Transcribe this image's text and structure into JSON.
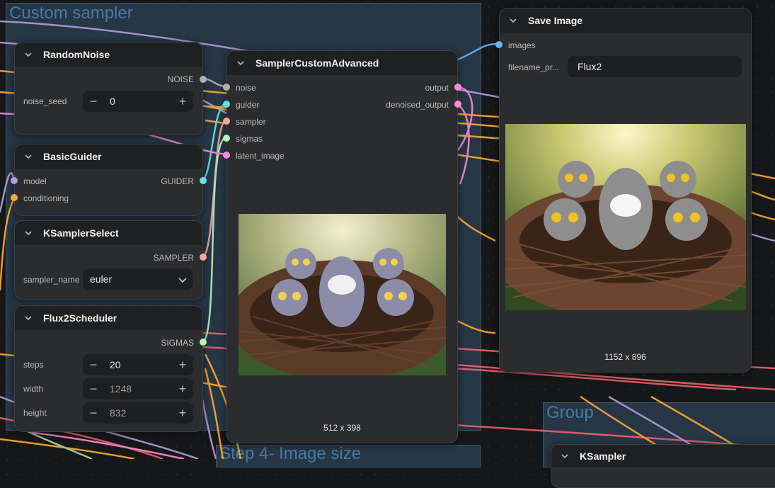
{
  "groups": {
    "custom_sampler": "Custom sampler",
    "step4": "Step 4- Image size",
    "group": "Group"
  },
  "nodes": {
    "random_noise": {
      "title": "RandomNoise",
      "output_noise": "NOISE",
      "noise_seed_label": "noise_seed",
      "noise_seed_value": "0"
    },
    "basic_guider": {
      "title": "BasicGuider",
      "input_model": "model",
      "input_conditioning": "conditioning",
      "output_guider": "GUIDER"
    },
    "ksampler_select": {
      "title": "KSamplerSelect",
      "output_sampler": "SAMPLER",
      "sampler_name_label": "sampler_name",
      "sampler_name_value": "euler"
    },
    "flux2_scheduler": {
      "title": "Flux2Scheduler",
      "output_sigmas": "SIGMAS",
      "steps_label": "steps",
      "steps_value": "20",
      "width_label": "width",
      "width_value": "1248",
      "height_label": "height",
      "height_value": "832"
    },
    "sampler_custom_advanced": {
      "title": "SamplerCustomAdvanced",
      "input_noise": "noise",
      "input_guider": "guider",
      "input_sampler": "sampler",
      "input_sigmas": "sigmas",
      "input_latent": "latent_image",
      "output_output": "output",
      "output_denoised": "denoised_output",
      "preview_size": "512 x 398"
    },
    "save_image": {
      "title": "Save Image",
      "input_images": "images",
      "filename_prefix_label": "filename_pr...",
      "filename_prefix_value": "Flux2",
      "image_size": "1152 x 896"
    },
    "ksampler": {
      "title": "KSampler"
    }
  },
  "icons": {
    "collapse": "chevron-down-icon",
    "minus": "minus-icon",
    "plus": "plus-icon",
    "dropdown": "chevron-down-icon"
  },
  "colors": {
    "noise": "#b0b0b0",
    "guider": "#66e0e8",
    "sampler": "#f2a7a0",
    "sigmas": "#b9f2b4",
    "latent": "#ff8ad8",
    "model": "#b39ddb",
    "conditioning": "#ffa931",
    "image": "#64b5f6",
    "wire_red": "#e8626b"
  }
}
